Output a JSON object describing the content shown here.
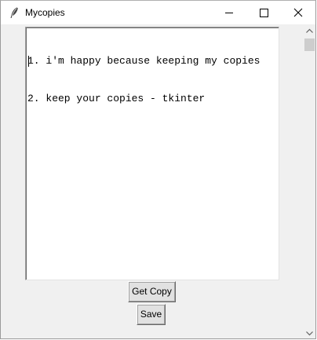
{
  "window": {
    "title": "Mycopies",
    "app_icon": "feather-icon",
    "controls": {
      "minimize": "minimize-icon",
      "maximize": "maximize-icon",
      "close": "close-icon"
    }
  },
  "editor": {
    "lines": [
      "1. i'm happy because keeping my copies",
      "2. keep your copies - tkinter"
    ]
  },
  "buttons": {
    "get_copy": "Get Copy",
    "save": "Save"
  },
  "scrollbar": {
    "up_icon": "chevron-up-icon",
    "down_icon": "chevron-down-icon"
  },
  "colors": {
    "window_bg": "#f0f0f0",
    "titlebar_bg": "#ffffff",
    "button_bg": "#e1e1e1",
    "scroll_thumb": "#cdcdcd"
  }
}
